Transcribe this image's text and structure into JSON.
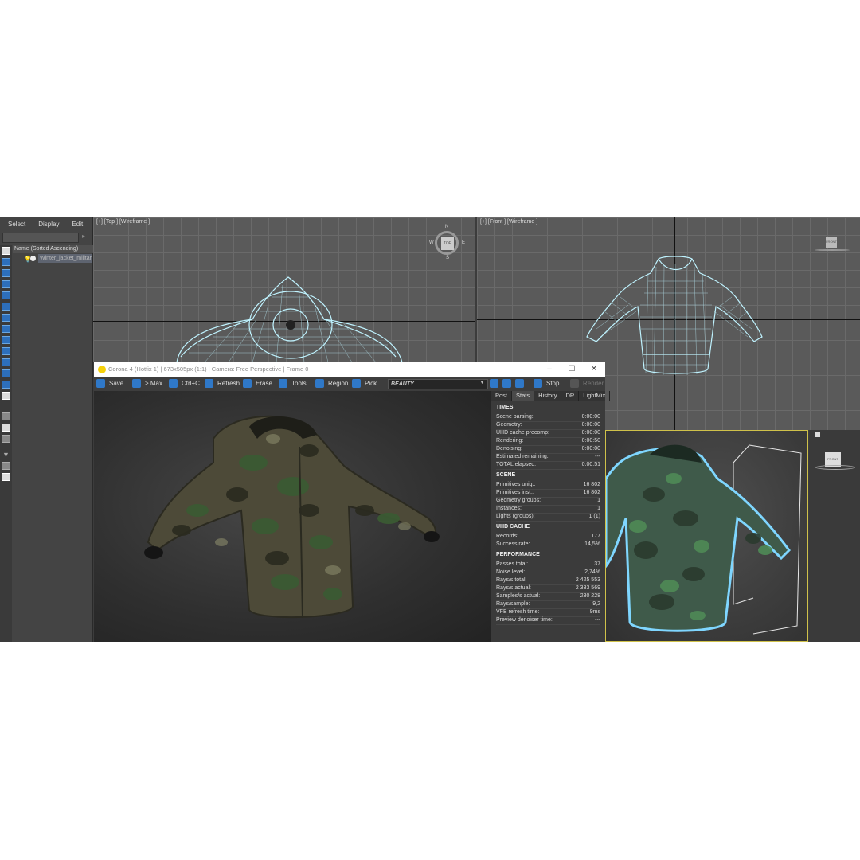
{
  "explorer": {
    "menu": [
      "Select",
      "Display",
      "Edit"
    ],
    "header": "Name (Sorted Ascending)",
    "object_name": "Winter_jacket_militar"
  },
  "viewports": {
    "top_label": "[+] [Top ] [Wireframe ]",
    "front_label": "[+] [Front ] [Wireframe ]",
    "compass": {
      "n": "N",
      "s": "S",
      "e": "E",
      "w": "W",
      "cube": "TOP"
    },
    "front_cube": "FRONT",
    "persp_cube": "FRONT"
  },
  "vfb": {
    "title": "Corona 4 (Hotfix 1) | 673x505px (1:1) | Camera: Free Perspective | Frame 0",
    "toolbar": {
      "save": "Save",
      "max": "> Max",
      "copy": "Ctrl+C",
      "refresh": "Refresh",
      "erase": "Erase",
      "tools": "Tools",
      "region": "Region",
      "pick": "Pick",
      "channel": "BEAUTY",
      "stop": "Stop",
      "render": "Render"
    },
    "tabs": [
      "Post",
      "Stats",
      "History",
      "DR",
      "LightMix"
    ],
    "stats": {
      "times": {
        "title": "TIMES",
        "rows": [
          {
            "k": "Scene parsing:",
            "v": "0:00:00"
          },
          {
            "k": "Geometry:",
            "v": "0:00:00"
          },
          {
            "k": "UHD cache precomp:",
            "v": "0:00:00"
          },
          {
            "k": "Rendering:",
            "v": "0:00:50"
          },
          {
            "k": "Denoising:",
            "v": "0:00:00"
          },
          {
            "k": "Estimated remaining:",
            "v": "---"
          },
          {
            "k": "TOTAL elapsed:",
            "v": "0:00:51"
          }
        ]
      },
      "scene": {
        "title": "SCENE",
        "rows": [
          {
            "k": "Primitives uniq.:",
            "v": "16 802"
          },
          {
            "k": "Primitives inst.:",
            "v": "16 802"
          },
          {
            "k": "Geometry groups:",
            "v": "1"
          },
          {
            "k": "Instances:",
            "v": "1"
          },
          {
            "k": "Lights (groups):",
            "v": "1 (1)"
          }
        ]
      },
      "uhd": {
        "title": "UHD CACHE",
        "rows": [
          {
            "k": "Records:",
            "v": "177"
          },
          {
            "k": "Success rate:",
            "v": "14,5%"
          }
        ]
      },
      "performance": {
        "title": "PERFORMANCE",
        "rows": [
          {
            "k": "Passes total:",
            "v": "37"
          },
          {
            "k": "Noise level:",
            "v": "2,74%"
          },
          {
            "k": "Rays/s total:",
            "v": "2 425 553"
          },
          {
            "k": "Rays/s actual:",
            "v": "2 333 569"
          },
          {
            "k": "Samples/s actual:",
            "v": "230 228"
          },
          {
            "k": "Rays/sample:",
            "v": "9,2"
          },
          {
            "k": "VFB refresh time:",
            "v": "9ms"
          },
          {
            "k": "Preview denoiser time:",
            "v": "---"
          }
        ]
      }
    }
  }
}
